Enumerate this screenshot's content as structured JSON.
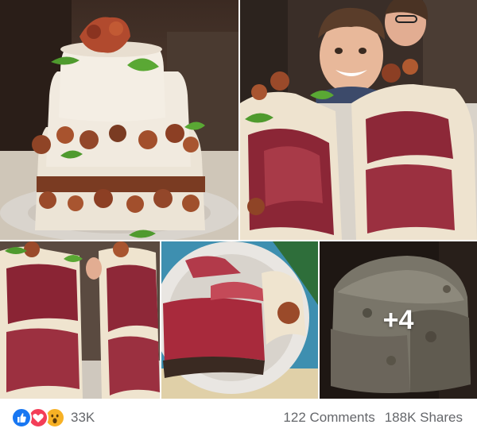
{
  "gallery": {
    "tiles": [
      {
        "subject": "steak cake with mashed potato frosting, bacon and basil"
      },
      {
        "subject": "sliced steak cake with smiling boy and girl behind"
      },
      {
        "subject": "cut cake showing rare steak layers"
      },
      {
        "subject": "slice of steak cake on plate"
      },
      {
        "subject": "whole cake frosted with mashed potatoes",
        "more_label": "+4"
      }
    ]
  },
  "reactions": {
    "icons": [
      "like-icon",
      "love-icon",
      "wow-icon"
    ],
    "count": "33K"
  },
  "stats": {
    "comments": "122 Comments",
    "shares": "188K Shares"
  },
  "colors": {
    "like": "#1877f2",
    "love": "#f33e58",
    "wow": "#f7b125",
    "meta_text": "#65676b"
  }
}
